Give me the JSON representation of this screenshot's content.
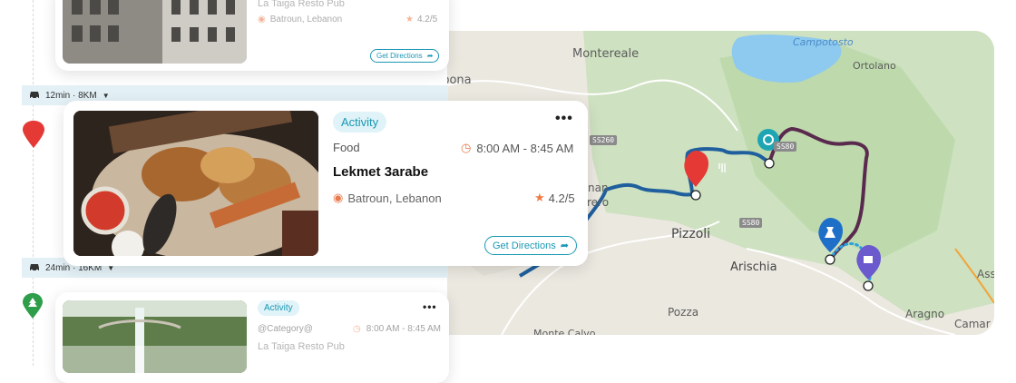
{
  "map": {
    "labels": {
      "monteleale": "Montereale",
      "borbona": "Borbona",
      "campotosto": "Campotosto",
      "ortolano": "Ortolano",
      "pizzoli": "Pizzoli",
      "arischia": "Arischia",
      "pozza": "Pozza",
      "aragno": "Aragno",
      "camar": "Camar",
      "ass": "Ass",
      "amatrice_partial": "nan",
      "verso_partial": "rero",
      "monte_calvo": "Monte Calvo"
    },
    "roads": {
      "ss260": "SS260",
      "ss80a": "SS80",
      "ss80b": "SS80"
    },
    "colors": {
      "route_blue": "#1f5f9e",
      "route_purple": "#5a2a4e",
      "route_dotted": "#2ba3e0"
    },
    "markers": [
      "food-marker",
      "attraction-marker",
      "science-marker",
      "lodging-marker"
    ]
  },
  "timeline": {
    "travel_1": {
      "text": "12min · 8KM"
    },
    "travel_2": {
      "text": "24min · 16KM"
    }
  },
  "cards": {
    "top": {
      "location": "Batroun, Lebanon",
      "rating": "4.2/5",
      "directions": "Get Directions",
      "title_partial": "La Taiga Resto Pub"
    },
    "main": {
      "badge": "Activity",
      "category": "Food",
      "time": "8:00 AM - 8:45 AM",
      "title": "Lekmet 3arabe",
      "location": "Batroun, Lebanon",
      "rating": "4.2/5",
      "directions": "Get Directions",
      "more": "•••"
    },
    "bottom": {
      "badge": "Activity",
      "category": "@Category@",
      "time": "8:00 AM - 8:45 AM",
      "title": "La Taiga Resto Pub",
      "more": "•••"
    }
  }
}
